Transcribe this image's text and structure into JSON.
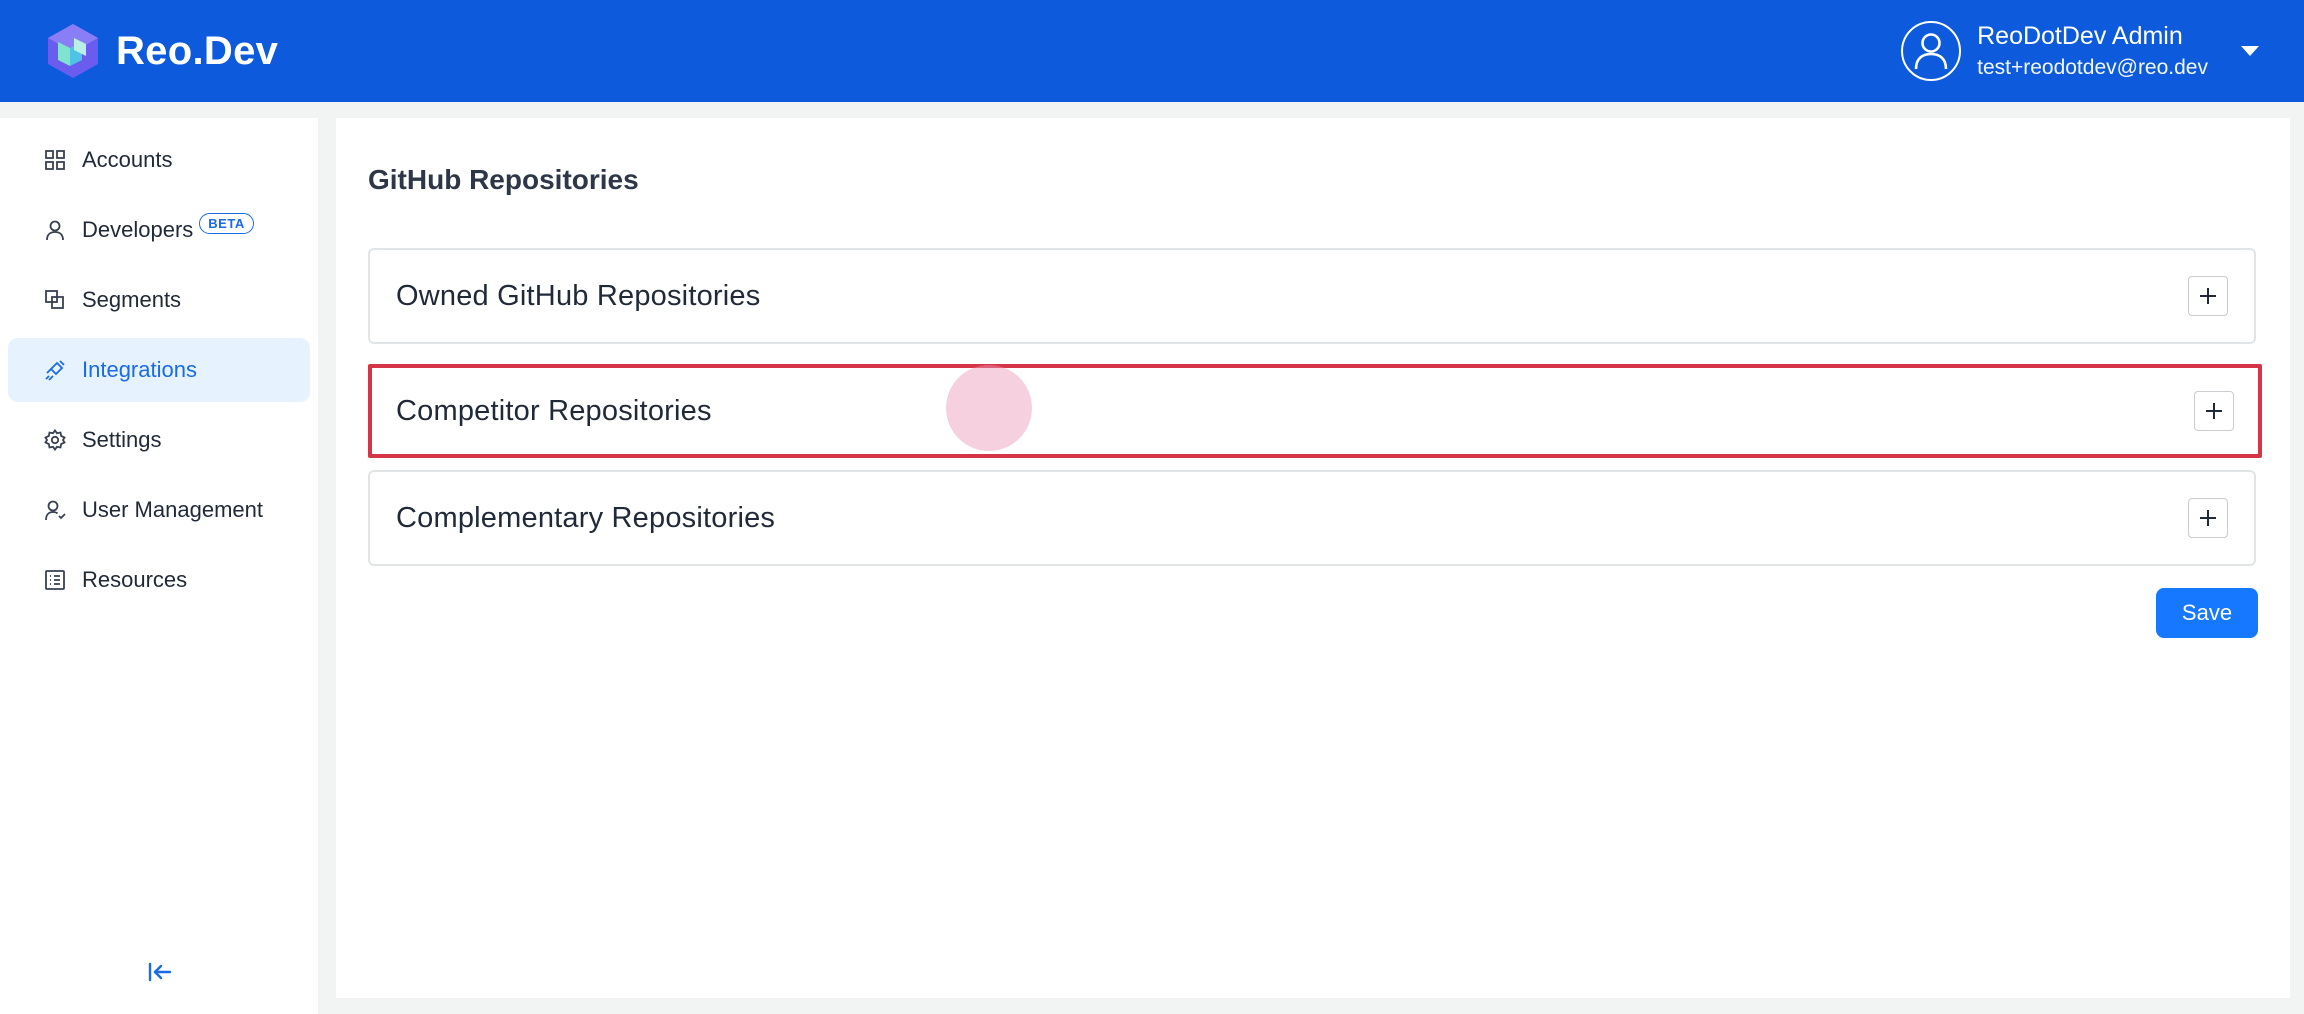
{
  "header": {
    "brand_name": "Reo.Dev",
    "user_name": "ReoDotDev Admin",
    "user_email": "test+reodotdev@reo.dev",
    "colors": {
      "bar": "#0d5bdc"
    }
  },
  "sidebar": {
    "items": [
      {
        "label": "Accounts",
        "icon": "grid-icon",
        "active": false
      },
      {
        "label": "Developers",
        "icon": "user-icon",
        "badge": "BETA",
        "active": false
      },
      {
        "label": "Segments",
        "icon": "segments-icon",
        "active": false
      },
      {
        "label": "Integrations",
        "icon": "plug-icon",
        "active": true
      },
      {
        "label": "Settings",
        "icon": "gear-icon",
        "active": false
      },
      {
        "label": "User Management",
        "icon": "user-manage-icon",
        "active": false
      },
      {
        "label": "Resources",
        "icon": "list-icon",
        "active": false
      }
    ],
    "collapse_icon": "collapse-left-icon"
  },
  "main": {
    "title": "GitHub Repositories",
    "sections": [
      {
        "label": "Owned GitHub Repositories",
        "action_icon": "plus-icon"
      },
      {
        "label": "Competitor Repositories",
        "action_icon": "plus-icon",
        "highlighted": true
      },
      {
        "label": "Complementary Repositories",
        "action_icon": "plus-icon"
      }
    ],
    "save_label": "Save"
  }
}
